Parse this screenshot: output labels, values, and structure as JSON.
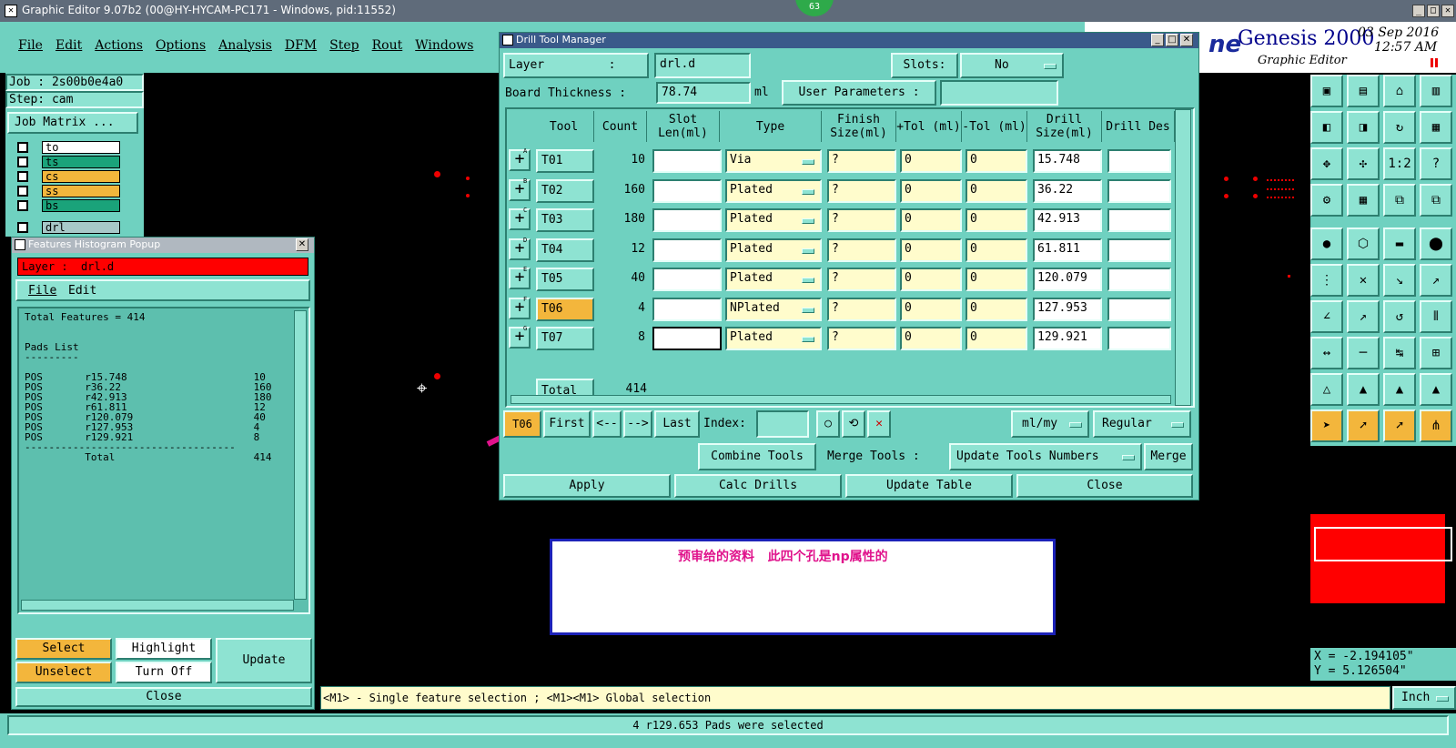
{
  "main_window": {
    "title": "Graphic Editor 9.07b2 (00@HY-HYCAM-PC171 - Windows, pid:11552)",
    "badge": "63"
  },
  "menu": [
    "File",
    "Edit",
    "Actions",
    "Options",
    "Analysis",
    "DFM",
    "Step",
    "Rout",
    "Windows"
  ],
  "job": {
    "job": "Job : 2s00b0e4a0",
    "step": "Step: cam",
    "matrix_button": "Job Matrix ..."
  },
  "layers": [
    {
      "name": "to",
      "color": "#ffffff"
    },
    {
      "name": "ts",
      "color": "#1aa37a"
    },
    {
      "name": "cs",
      "color": "#f3b63c"
    },
    {
      "name": "ss",
      "color": "#f3b63c"
    },
    {
      "name": "bs",
      "color": "#1aa37a"
    },
    {
      "name": "drl",
      "color": "#a8c8c8"
    }
  ],
  "brand": {
    "logo": "ne",
    "title": "Genesis 2000",
    "subtitle": "Graphic Editor",
    "date": "03 Sep 2016",
    "time": "12:57 AM"
  },
  "histogram": {
    "title": "Features Histogram Popup",
    "layer_label": "Layer :  drl.d",
    "menu": [
      "File",
      "Edit"
    ],
    "total_line": "Total Features = 414",
    "pads_heading": "Pads List",
    "separator_short": "---------",
    "rows": [
      [
        "POS",
        "r15.748",
        "10"
      ],
      [
        "POS",
        "r36.22",
        "160"
      ],
      [
        "POS",
        "r42.913",
        "180"
      ],
      [
        "POS",
        "r61.811",
        "12"
      ],
      [
        "POS",
        "r120.079",
        "40"
      ],
      [
        "POS",
        "r127.953",
        "4"
      ],
      [
        "POS",
        "r129.921",
        "8"
      ]
    ],
    "separator_long": "-----------------------------------",
    "total_label": "Total",
    "total_value": "414",
    "buttons": {
      "select": "Select",
      "highlight": "Highlight",
      "update": "Update",
      "unselect": "Unselect",
      "turn_off": "Turn Off",
      "close": "Close"
    }
  },
  "dtm": {
    "title": "Drill Tool Manager",
    "layer_label": "Layer         :",
    "layer_value": "drl.d",
    "slots_label": "Slots:",
    "slots_value": "No",
    "board_label": "Board Thickness :",
    "board_value": "78.74",
    "board_unit": "ml",
    "user_params": "User Parameters :",
    "headers": [
      "Tool",
      "Count",
      "Slot Len(ml)",
      "Type",
      "Finish Size(ml)",
      "+Tol (ml)",
      "-Tol (ml)",
      "Drill Size(ml)",
      "Drill Des"
    ],
    "rows": [
      {
        "tool": "T01",
        "count": "10",
        "type": "Via",
        "finish": "?",
        "ptol": "0",
        "mtol": "0",
        "drill": "15.748",
        "mark": "A"
      },
      {
        "tool": "T02",
        "count": "160",
        "type": "Plated",
        "finish": "?",
        "ptol": "0",
        "mtol": "0",
        "drill": "36.22",
        "mark": "B"
      },
      {
        "tool": "T03",
        "count": "180",
        "type": "Plated",
        "finish": "?",
        "ptol": "0",
        "mtol": "0",
        "drill": "42.913",
        "mark": "C"
      },
      {
        "tool": "T04",
        "count": "12",
        "type": "Plated",
        "finish": "?",
        "ptol": "0",
        "mtol": "0",
        "drill": "61.811",
        "mark": "D"
      },
      {
        "tool": "T05",
        "count": "40",
        "type": "Plated",
        "finish": "?",
        "ptol": "0",
        "mtol": "0",
        "drill": "120.079",
        "mark": "E"
      },
      {
        "tool": "T06",
        "count": "4",
        "type": "NPlated",
        "finish": "?",
        "ptol": "0",
        "mtol": "0",
        "drill": "127.953",
        "mark": "F"
      },
      {
        "tool": "T07",
        "count": "8",
        "type": "Plated",
        "finish": "?",
        "ptol": "0",
        "mtol": "0",
        "drill": "129.921",
        "mark": "G"
      }
    ],
    "total_label": "Total",
    "total_value": "414",
    "nav": {
      "current": "T06",
      "first": "First",
      "prev": "<--",
      "next": "-->",
      "last": "Last",
      "index": "Index:",
      "units": "ml/my",
      "mode": "Regular"
    },
    "combine": "Combine Tools",
    "merge_label": "Merge Tools :",
    "update_numbers": "Update Tools Numbers",
    "merge": "Merge",
    "actions": {
      "apply": "Apply",
      "calc": "Calc Drills",
      "update_table": "Update Table",
      "close": "Close"
    }
  },
  "annotation": {
    "text": "预审给的资料   此四个孔是np属性的",
    "color": "#e0138c"
  },
  "toolbox": [
    "▣",
    "▤",
    "⌂",
    "▥",
    "◧",
    "◨",
    "↻",
    "▦",
    "✥",
    "✣",
    "1:2",
    "?",
    "⚙",
    "▦",
    "⧉",
    "⧉",
    "●",
    "⬡",
    "▬",
    "⬤",
    "⋮",
    "✕",
    "↘",
    "↗",
    "∠",
    "↗",
    "↺",
    "⫴",
    "↔",
    "─",
    "↹",
    "⊞",
    "△",
    "▲",
    "▲",
    "▲",
    "➤",
    "➚",
    "➚",
    "⋔"
  ],
  "coords": {
    "x": "X = -2.194105\"",
    "y": "Y = 5.126504\""
  },
  "status": {
    "hint": "<M1> - Single feature selection ; <M1><M1> Global selection",
    "units": "Inch",
    "selected": "4 r129.653 Pads were selected"
  }
}
